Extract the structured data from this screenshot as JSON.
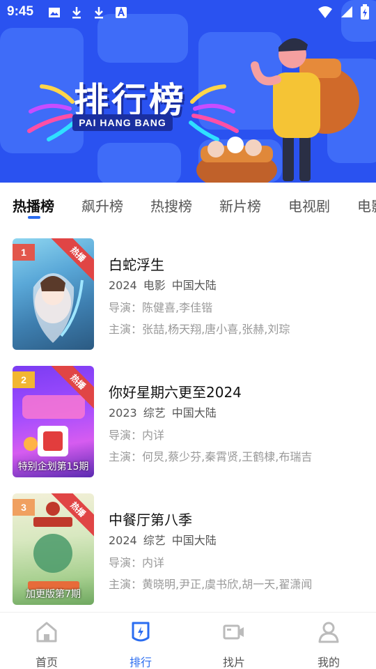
{
  "status_bar": {
    "time": "9:45",
    "notification_icons": [
      "image-icon",
      "download-icon",
      "download-icon",
      "font-icon"
    ],
    "system_icons": [
      "wifi-icon",
      "signal-icon",
      "battery-charging-icon"
    ]
  },
  "banner": {
    "title": "排行榜",
    "subtitle": "PAI HANG BANG",
    "bg_color": "#2a52f0"
  },
  "tabs": [
    {
      "label": "热播榜",
      "active": true
    },
    {
      "label": "飙升榜",
      "active": false
    },
    {
      "label": "热搜榜",
      "active": false
    },
    {
      "label": "新片榜",
      "active": false
    },
    {
      "label": "电视剧",
      "active": false
    },
    {
      "label": "电影",
      "active": false
    }
  ],
  "list": [
    {
      "rank": "1",
      "badge": "热播",
      "rank_color": "#e2574c",
      "caption": "",
      "title": "白蛇浮生",
      "meta": [
        "2024",
        "电影",
        "中国大陆"
      ],
      "director": "导演：陈健喜,李佳锴",
      "cast": "主演：张喆,杨天翔,唐小喜,张赫,刘琮"
    },
    {
      "rank": "2",
      "badge": "热播",
      "rank_color": "#f2b632",
      "caption": "特别企划第15期",
      "title": "你好星期六更至2024",
      "meta": [
        "2023",
        "综艺",
        "中国大陆"
      ],
      "director": "导演：内详",
      "cast": "主演：何炅,蔡少芬,秦霄贤,王鹤棣,布瑞吉"
    },
    {
      "rank": "3",
      "badge": "热播",
      "rank_color": "#f0a060",
      "caption": "加更版第7期",
      "title": "中餐厅第八季",
      "meta": [
        "2024",
        "综艺",
        "中国大陆"
      ],
      "director": "导演：内详",
      "cast": "主演：黄晓明,尹正,虞书欣,胡一天,翟潇闻"
    }
  ],
  "bottom_nav": [
    {
      "label": "首页",
      "icon": "home-icon",
      "active": false
    },
    {
      "label": "排行",
      "icon": "ranking-icon",
      "active": true
    },
    {
      "label": "找片",
      "icon": "video-camera-icon",
      "active": false
    },
    {
      "label": "我的",
      "icon": "user-icon",
      "active": false
    }
  ],
  "colors": {
    "accent": "#2a6cf0",
    "badge": "#e04545"
  }
}
